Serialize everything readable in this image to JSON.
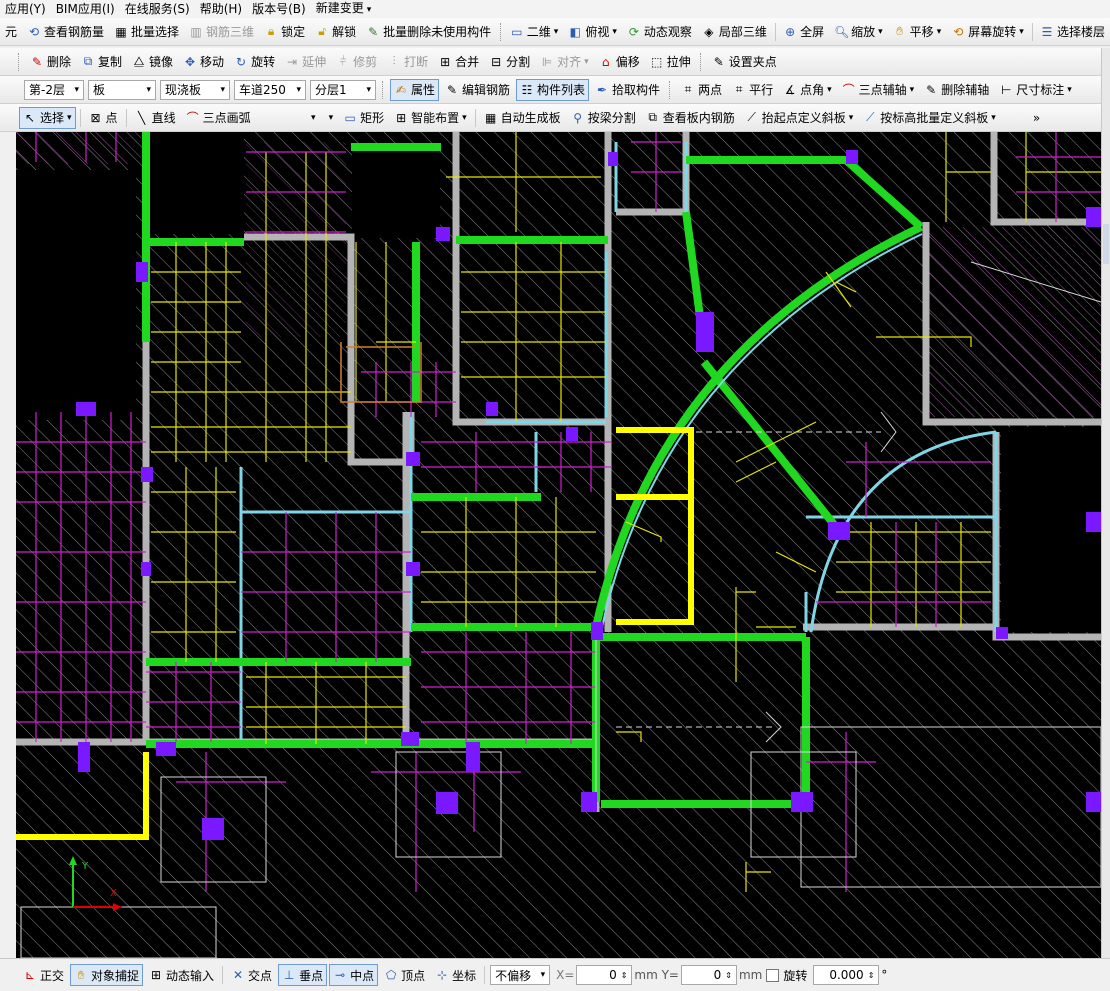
{
  "menubar": {
    "items": [
      "应用(Y)",
      "BIM应用(I)",
      "在线服务(S)",
      "帮助(H)",
      "版本号(B)",
      "新建变更"
    ]
  },
  "toolbar1": {
    "partial_left": "元",
    "view_rebar": "查看钢筋量",
    "batch_select": "批量选择",
    "rebar_3d": "钢筋三维",
    "lock": "锁定",
    "unlock": "解锁",
    "batch_delete": "批量删除未使用构件",
    "view_2d": "二维",
    "top_view": "俯视",
    "dynamic_view": "动态观察",
    "local_3d": "局部三维",
    "full_screen": "全屏",
    "zoom": "缩放",
    "pan": "平移",
    "screen_rotate": "屏幕旋转",
    "select_floor": "选择楼层"
  },
  "toolbar2": {
    "delete": "删除",
    "copy": "复制",
    "mirror": "镜像",
    "move": "移动",
    "rotate": "旋转",
    "extend": "延伸",
    "trim": "修剪",
    "break": "打断",
    "merge": "合并",
    "split": "分割",
    "align": "对齐",
    "offset": "偏移",
    "stretch": "拉伸",
    "set_grip": "设置夹点"
  },
  "toolbar3": {
    "floor": "第-2层",
    "category": "板",
    "type": "现浇板",
    "element": "车道250",
    "sublayer": "分层1",
    "properties": "属性",
    "edit_rebar": "编辑钢筋",
    "component_list": "构件列表",
    "pick_component": "拾取构件",
    "two_point": "两点",
    "parallel": "平行",
    "point_angle": "点角",
    "three_point_axis": "三点辅轴",
    "delete_axis": "删除辅轴",
    "dimension": "尺寸标注"
  },
  "toolbar4": {
    "select": "选择",
    "point": "点",
    "line": "直线",
    "arc": "三点画弧",
    "rect": "矩形",
    "smart_layout": "智能布置",
    "auto_generate": "自动生成板",
    "split_by_beam": "按梁分割",
    "view_slab_rebar": "查看板内钢筋",
    "define_slope_by_points": "抬起点定义斜板",
    "batch_define_slope": "按标高批量定义斜板",
    "more": "»"
  },
  "statusbar": {
    "ortho": "正交",
    "snap": "对象捕捉",
    "dynamic_input": "动态输入",
    "intersection": "交点",
    "perpendicular": "垂点",
    "midpoint": "中点",
    "vertex": "顶点",
    "coordinate": "坐标",
    "offset_mode": "不偏移",
    "x_label": "X=",
    "x_value": "0",
    "y_label": "mm Y=",
    "y_value": "0",
    "mm": "mm",
    "rotate_label": "旋转",
    "rotate_value": "0.000",
    "degree": "°"
  },
  "canvas": {
    "axis_x": "X",
    "axis_y": "Y",
    "colors": {
      "background": "#000000",
      "hatch": "#8a8a8a",
      "beam_green": "#1fd81f",
      "beam_cyan": "#7fd6e6",
      "wall_gray": "#b4b4b4",
      "rebar_magenta": "#d020d0",
      "rebar_yellow": "#e6e600",
      "column_purple": "#7a18ff",
      "yellow_wall": "#ffff00"
    }
  }
}
